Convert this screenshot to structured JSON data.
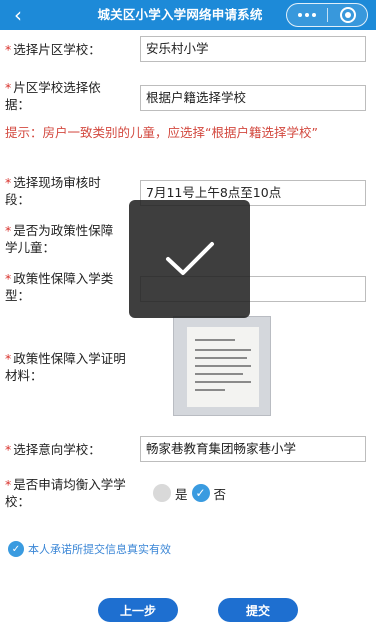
{
  "header": {
    "back_icon": "chevron-left-icon",
    "title": "城关区小学入学网络申请系统",
    "more_icon": "more-dots-icon",
    "close_icon": "target-close-icon"
  },
  "form": {
    "required_mark": "*",
    "district_school": {
      "label": "选择片区学校：",
      "value": "安乐村小学"
    },
    "school_basis": {
      "label_line1": "片区学校选择依",
      "label_line2": "据：",
      "value": "根据户籍选择学校"
    },
    "hint": "提示：房户一致类别的儿童，应选择“根据户籍选择学校”",
    "review_time": {
      "label_line1": "选择现场审核时",
      "label_line2": "段：",
      "value": "7月11号上午8点至10点"
    },
    "policy_child": {
      "label_line1": "是否为政策性保障",
      "label_line2": "学儿童："
    },
    "policy_type": {
      "label_line1": "政策性保障入学类",
      "label_line2": "型：",
      "value": ""
    },
    "policy_material": {
      "label_line1": "政策性保障入学证明",
      "label_line2": "材料："
    },
    "intent_school": {
      "label": "选择意向学校：",
      "value": "畅家巷教育集团畅家巷小学"
    },
    "balanced_apply": {
      "label_line1": "是否申请均衡入学学",
      "label_line2": "校：",
      "options": [
        {
          "label": "是",
          "checked": false
        },
        {
          "label": "否",
          "checked": true
        }
      ]
    },
    "agreement": "本人承诺所提交信息真实有效"
  },
  "buttons": {
    "prev": "上一步",
    "submit": "提交"
  },
  "toast": {
    "icon": "checkmark-icon"
  },
  "colors": {
    "header_bg": "#1d8ad8",
    "required": "#d9312b",
    "hint": "#d34a40",
    "accent": "#3a9be0",
    "button_bg": "#1e6fd0",
    "agreement_text": "#3a86d6"
  }
}
